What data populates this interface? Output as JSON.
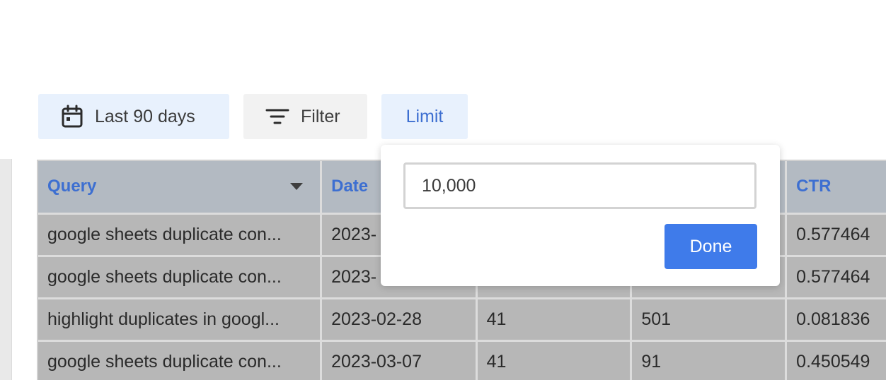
{
  "toolbar": {
    "date_range_label": "Last 90 days",
    "filter_label": "Filter",
    "limit_label": "Limit"
  },
  "table": {
    "columns": [
      "Query",
      "Date",
      "",
      "",
      "CTR"
    ],
    "rows": [
      [
        "google sheets duplicate con...",
        "2023-",
        "",
        "",
        "0.577464"
      ],
      [
        "google sheets duplicate con...",
        "2023-",
        "",
        "",
        "0.577464"
      ],
      [
        "highlight duplicates in googl...",
        "2023-02-28",
        "41",
        "501",
        "0.081836"
      ],
      [
        "google sheets duplicate con...",
        "2023-03-07",
        "41",
        "91",
        "0.450549"
      ]
    ]
  },
  "limit_popover": {
    "value": "10,000",
    "done_label": "Done"
  },
  "colors": {
    "accent": "#3f7bea",
    "link_blue": "#3d6fd1",
    "chip_bg": "#e8f1fd"
  }
}
